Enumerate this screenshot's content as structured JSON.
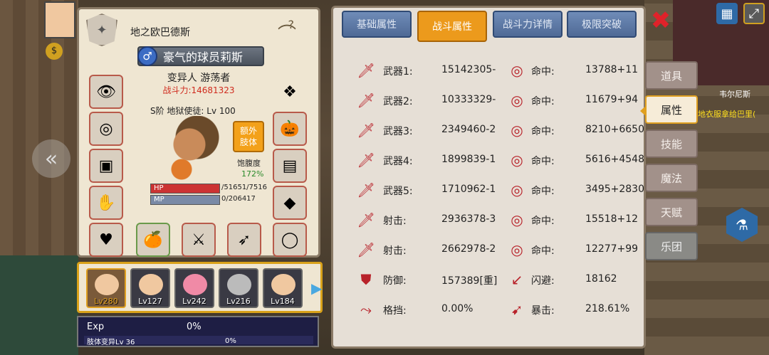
{
  "character": {
    "guild_name": "地之欧巴德斯",
    "player_name": "豪气的球员莉斯",
    "class_name": "变异人 游荡者",
    "combat_power": "战斗力:14681323",
    "rank": "S阶 地狱使徒: Lv 100",
    "extra_limb_label": "额外\n肢体",
    "satiety_label": "饱腹度",
    "satiety_value": "172%",
    "hp_label": "HP",
    "mp_label": "MP",
    "hp_value": "/51651/7516",
    "mp_value": "0/206417",
    "help_icon": "?"
  },
  "team": [
    {
      "level": "Lv280",
      "active": true
    },
    {
      "level": "Lv127",
      "active": false
    },
    {
      "level": "Lv242",
      "active": false
    },
    {
      "level": "Lv216",
      "active": false
    },
    {
      "level": "Lv184",
      "active": false
    }
  ],
  "exp": {
    "label": "Exp",
    "percent": "0%",
    "sub_label": "肢体变异Lv 36",
    "sub_percent": "0%"
  },
  "tabs": {
    "basic": "基础属性",
    "combat": "战斗属性",
    "power_detail": "战斗力详情",
    "limit_break": "极限突破"
  },
  "stats": [
    {
      "label": "武器1:",
      "value": "15142305-",
      "label2": "命中:",
      "value2": "13788+11"
    },
    {
      "label": "武器2:",
      "value": "10333329-",
      "label2": "命中:",
      "value2": "11679+94"
    },
    {
      "label": "武器3:",
      "value": "2349460-2",
      "label2": "命中:",
      "value2": "8210+6650"
    },
    {
      "label": "武器4:",
      "value": "1899839-1",
      "label2": "命中:",
      "value2": "5616+4548"
    },
    {
      "label": "武器5:",
      "value": "1710962-1",
      "label2": "命中:",
      "value2": "3495+2830"
    },
    {
      "label": "射击:",
      "value": "2936378-3",
      "label2": "命中:",
      "value2": "15518+12"
    },
    {
      "label": "射击:",
      "value": "2662978-2",
      "label2": "命中:",
      "value2": "12277+99"
    },
    {
      "label": "防御:",
      "value": "157389[重]",
      "label2": "闪避:",
      "value2": "18162"
    },
    {
      "label": "格挡:",
      "value": "0.00%",
      "label2": "暴击:",
      "value2": "218.61%"
    }
  ],
  "side_nav": {
    "items": [
      "道具",
      "属性",
      "技能",
      "魔法",
      "天赋",
      "乐团"
    ],
    "active_index": 1
  },
  "map": {
    "label1": "韦尔尼斯",
    "label2": "地衣服拿给巴里(",
    "close_icon": "✖"
  },
  "colors": {
    "accent_orange": "#ec9a1c",
    "tab_blue": "#4f6a96",
    "stat_red": "#b8222a",
    "power_red": "#d02b1e"
  }
}
